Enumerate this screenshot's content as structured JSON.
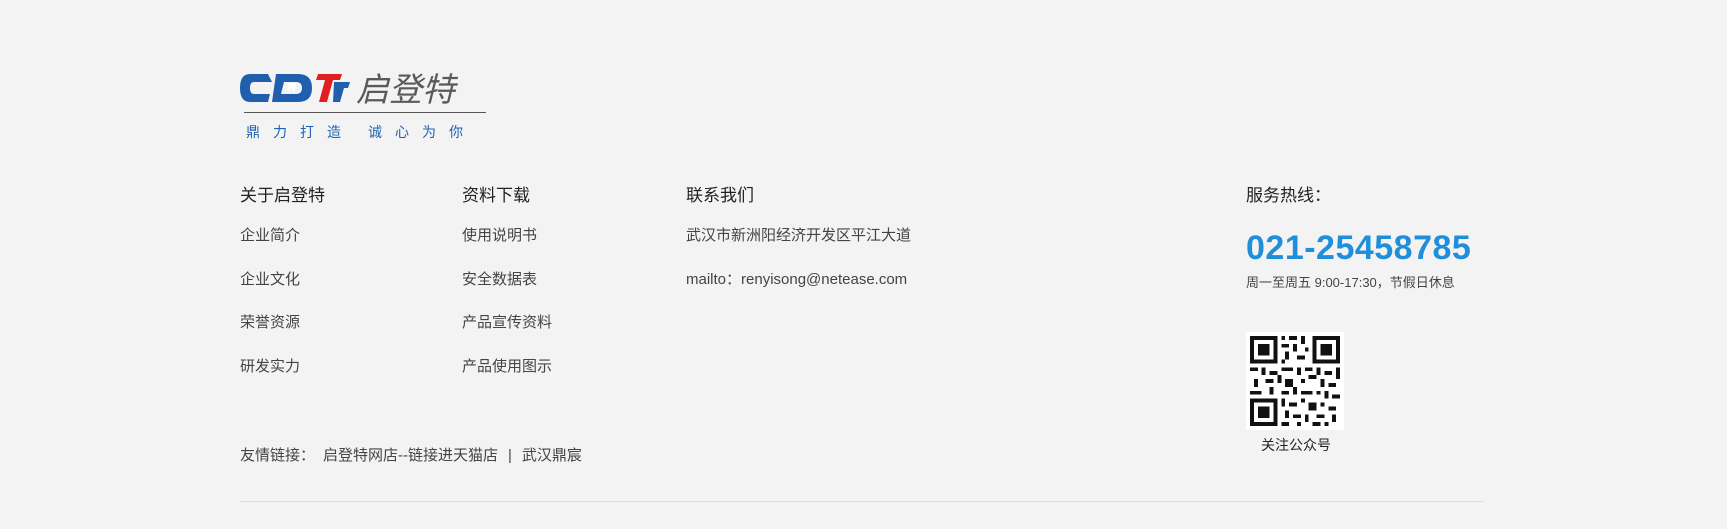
{
  "logo": {
    "brand_letters": "CDT",
    "brand_name": "启登特",
    "tagline_part1": "鼎力打造",
    "tagline_part2": "诚心为你",
    "primary_color": "#1f5fae",
    "accent_color": "#e02020"
  },
  "about": {
    "title": "关于启登特",
    "items": [
      "企业简介",
      "企业文化",
      "荣誉资源",
      "研发实力"
    ]
  },
  "downloads": {
    "title": "资料下载",
    "items": [
      "使用说明书",
      "安全数据表",
      "产品宣传资料",
      "产品使用图示"
    ]
  },
  "contact": {
    "title": "联系我们",
    "address": "武汉市新洲阳经济开发区平江大道",
    "email": "mailto：renyisong@netease.com"
  },
  "hotline": {
    "title": "服务热线：",
    "number": "021-25458785",
    "hours": "周一至周五 9:00-17:30，节假日休息",
    "number_color": "#1f8fdb"
  },
  "wechat": {
    "label": "关注公众号",
    "icon": "qr-code-icon"
  },
  "friend_links": {
    "label": "友情链接：",
    "links": [
      "启登特网店--链接进天猫店",
      "武汉鼎宸"
    ],
    "separator": "|"
  }
}
